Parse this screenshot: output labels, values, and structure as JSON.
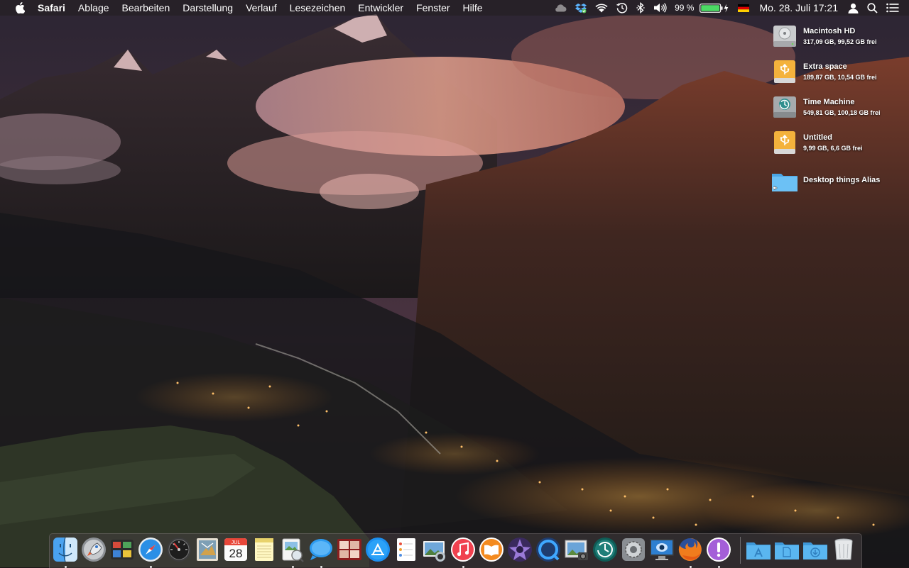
{
  "menubar": {
    "app_name": "Safari",
    "menus": [
      "Ablage",
      "Bearbeiten",
      "Darstellung",
      "Verlauf",
      "Lesezeichen",
      "Entwickler",
      "Fenster",
      "Hilfe"
    ],
    "battery_percent": "99 %",
    "clock": "Mo. 28. Juli  17:21",
    "status_icons": [
      "cloud-icon",
      "dropbox-icon",
      "wifi-icon",
      "time-machine-icon",
      "bluetooth-icon",
      "volume-icon",
      "battery-icon",
      "flag-de-icon",
      "user-icon",
      "spotlight-icon",
      "notification-center-icon"
    ]
  },
  "desktop_icons": [
    {
      "name": "Macintosh HD",
      "info": "317,09 GB, 99,52 GB frei",
      "icon": "hard-drive-icon"
    },
    {
      "name": "Extra space",
      "info": "189,87 GB, 10,54 GB frei",
      "icon": "usb-drive-icon"
    },
    {
      "name": "Time Machine",
      "info": "549,81 GB, 100,18 GB frei",
      "icon": "time-machine-drive-icon"
    },
    {
      "name": "Untitled",
      "info": "9,99 GB, 6,6 GB frei",
      "icon": "usb-drive-icon"
    },
    {
      "name": "Desktop things Alias",
      "info": "",
      "icon": "folder-alias-icon"
    }
  ],
  "dock": {
    "items": [
      {
        "icon": "finder-icon",
        "running": true
      },
      {
        "icon": "launchpad-icon",
        "running": false
      },
      {
        "icon": "mission-control-icon",
        "running": false
      },
      {
        "icon": "safari-icon",
        "running": true
      },
      {
        "icon": "dashboard-icon",
        "running": false
      },
      {
        "icon": "mail-icon",
        "running": false
      },
      {
        "icon": "calendar-icon",
        "running": false,
        "month": "JUL",
        "day": "28"
      },
      {
        "icon": "notes-icon",
        "running": false
      },
      {
        "icon": "preview-icon",
        "running": true
      },
      {
        "icon": "messages-icon",
        "running": true
      },
      {
        "icon": "photo-booth-icon",
        "running": false
      },
      {
        "icon": "app-store-icon",
        "running": false
      },
      {
        "icon": "reminders-icon",
        "running": false
      },
      {
        "icon": "iphoto-icon",
        "running": false
      },
      {
        "icon": "itunes-icon",
        "running": true
      },
      {
        "icon": "ibooks-icon",
        "running": false
      },
      {
        "icon": "imovie-icon",
        "running": false
      },
      {
        "icon": "quicktime-icon",
        "running": false
      },
      {
        "icon": "image-capture-icon",
        "running": false
      },
      {
        "icon": "time-machine-icon",
        "running": false
      },
      {
        "icon": "system-preferences-icon",
        "running": false
      },
      {
        "icon": "screen-sharing-icon",
        "running": false
      },
      {
        "icon": "firefox-icon",
        "running": true
      },
      {
        "icon": "podcasts-icon",
        "running": true
      },
      {
        "icon": "applications-folder-icon",
        "running": false
      },
      {
        "icon": "documents-folder-icon",
        "running": false
      },
      {
        "icon": "downloads-folder-icon",
        "running": false
      },
      {
        "icon": "trash-icon",
        "running": false
      }
    ]
  },
  "colors": {
    "menubar_bg": "#2a2226",
    "accent_blue": "#1a8cff",
    "battery_green": "#4cd964",
    "usb_drive": "#f4b23c",
    "folder_blue": "#5ab6f0"
  }
}
